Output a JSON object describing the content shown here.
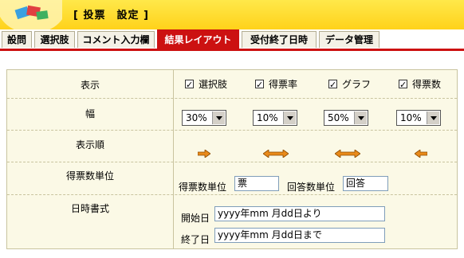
{
  "header": {
    "title": "[ 投票　設定 ]"
  },
  "tabs": [
    {
      "label": "設問"
    },
    {
      "label": "選択肢"
    },
    {
      "label": "コメント入力欄"
    },
    {
      "label": "結果レイアウト"
    },
    {
      "label": "受付終了日時"
    },
    {
      "label": "データ管理"
    }
  ],
  "rows": {
    "display": {
      "label": "表示",
      "options": [
        {
          "label": "選択肢",
          "checked": true
        },
        {
          "label": "得票率",
          "checked": true
        },
        {
          "label": "グラフ",
          "checked": true
        },
        {
          "label": "得票数",
          "checked": true
        }
      ]
    },
    "width": {
      "label": "幅",
      "values": [
        "30%",
        "10%",
        "50%",
        "10%"
      ]
    },
    "order": {
      "label": "表示順"
    },
    "unit": {
      "label": "得票数単位",
      "vote_unit_label": "得票数単位",
      "vote_unit_value": "票",
      "answer_unit_label": "回答数単位",
      "answer_unit_value": "回答"
    },
    "date": {
      "label": "日時書式",
      "start_label": "開始日",
      "start_value": "yyyy年mm 月dd日より",
      "end_label": "終了日",
      "end_value": "yyyy年mm 月dd日まで"
    }
  },
  "colors": {
    "header_yellow": "#ffd21a",
    "tab_active": "#cc1111",
    "arrow": "#e98a1a"
  }
}
